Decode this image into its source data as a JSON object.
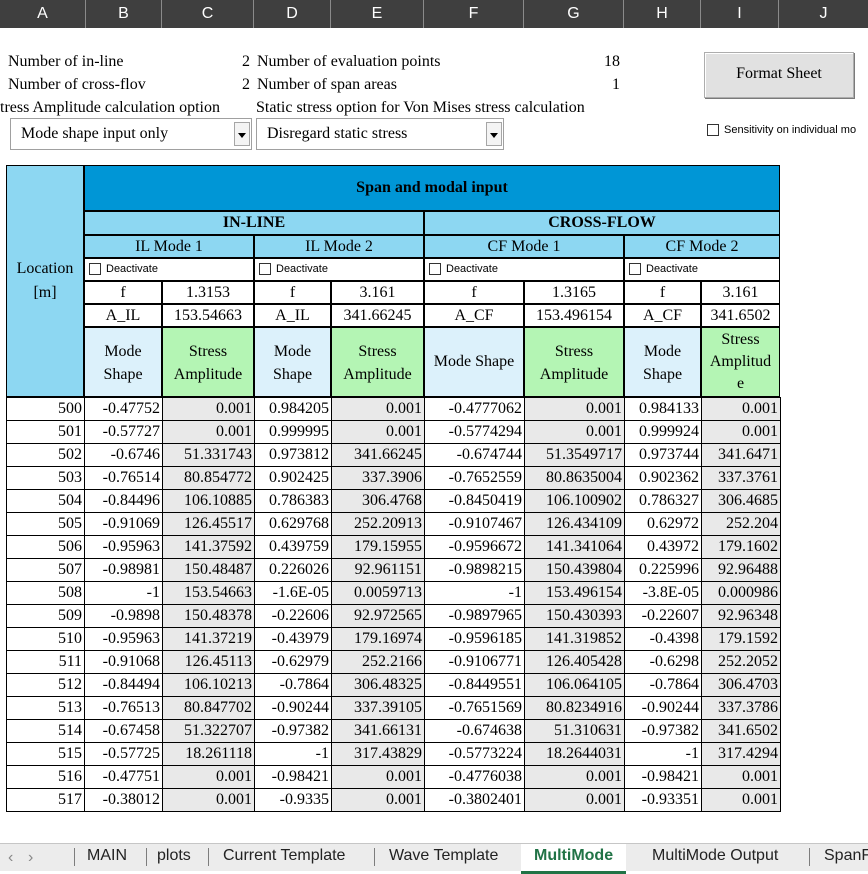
{
  "columns": [
    "A",
    "B",
    "C",
    "D",
    "E",
    "F",
    "G",
    "H",
    "I",
    "J"
  ],
  "info": {
    "inline_label": "Number of in-line",
    "inline_value": "2",
    "crossflow_label": "Number of cross-flov",
    "crossflow_value": "2",
    "eval_label": "Number of evaluation points",
    "eval_value": "18",
    "span_label": "Number of span areas",
    "span_value": "1",
    "stress_option_label": "tress Amplitude calculation option",
    "static_option_label": "Static stress option for Von Mises stress calculation"
  },
  "dropdowns": {
    "mode_shape": "Mode shape input only",
    "static_stress": "Disregard static stress"
  },
  "format_button": "Format Sheet",
  "sensitivity_label": "Sensitivity on individual mo",
  "table": {
    "title": "Span and modal input",
    "location_label_1": "Location",
    "location_label_2": "[m]",
    "inline": "IN-LINE",
    "crossflow": "CROSS-FLOW",
    "modes": [
      "IL Mode 1",
      "IL Mode 2",
      "CF Mode 1",
      "CF Mode 2"
    ],
    "deactivate": "Deactivate",
    "f_label": "f",
    "f_values": [
      "1.3153",
      "3.161",
      "1.3165",
      "3.161"
    ],
    "a_labels": [
      "A_IL",
      "A_IL",
      "A_CF",
      "A_CF"
    ],
    "a_values": [
      "153.54663",
      "341.66245",
      "153.496154",
      "341.6502"
    ],
    "mode_shape_1": "Mode",
    "mode_shape_2": "Shape",
    "mode_shape_full": "Mode Shape",
    "stress_1": "Stress",
    "stress_2": "Amplitude",
    "stress_a": "Amplitud",
    "stress_b": "e",
    "rows": [
      [
        "500",
        "-0.47752",
        "0.001",
        "0.984205",
        "0.001",
        "-0.4777062",
        "0.001",
        "0.984133",
        "0.001"
      ],
      [
        "501",
        "-0.57727",
        "0.001",
        "0.999995",
        "0.001",
        "-0.5774294",
        "0.001",
        "0.999924",
        "0.001"
      ],
      [
        "502",
        "-0.6746",
        "51.331743",
        "0.973812",
        "341.66245",
        "-0.674744",
        "51.3549717",
        "0.973744",
        "341.6471"
      ],
      [
        "503",
        "-0.76514",
        "80.854772",
        "0.902425",
        "337.3906",
        "-0.7652559",
        "80.8635004",
        "0.902362",
        "337.3761"
      ],
      [
        "504",
        "-0.84496",
        "106.10885",
        "0.786383",
        "306.4768",
        "-0.8450419",
        "106.100902",
        "0.786327",
        "306.4685"
      ],
      [
        "505",
        "-0.91069",
        "126.45517",
        "0.629768",
        "252.20913",
        "-0.9107467",
        "126.434109",
        "0.62972",
        "252.204"
      ],
      [
        "506",
        "-0.95963",
        "141.37592",
        "0.439759",
        "179.15955",
        "-0.9596672",
        "141.341064",
        "0.43972",
        "179.1602"
      ],
      [
        "507",
        "-0.98981",
        "150.48487",
        "0.226026",
        "92.961151",
        "-0.9898215",
        "150.439804",
        "0.225996",
        "92.96488"
      ],
      [
        "508",
        "-1",
        "153.54663",
        "-1.6E-05",
        "0.0059713",
        "-1",
        "153.496154",
        "-3.8E-05",
        "0.000986"
      ],
      [
        "509",
        "-0.9898",
        "150.48378",
        "-0.22606",
        "92.972565",
        "-0.9897965",
        "150.430393",
        "-0.22607",
        "92.96348"
      ],
      [
        "510",
        "-0.95963",
        "141.37219",
        "-0.43979",
        "179.16974",
        "-0.9596185",
        "141.319852",
        "-0.4398",
        "179.1592"
      ],
      [
        "511",
        "-0.91068",
        "126.45113",
        "-0.62979",
        "252.2166",
        "-0.9106771",
        "126.405428",
        "-0.6298",
        "252.2052"
      ],
      [
        "512",
        "-0.84494",
        "106.10213",
        "-0.7864",
        "306.48325",
        "-0.8449551",
        "106.064105",
        "-0.7864",
        "306.4703"
      ],
      [
        "513",
        "-0.76513",
        "80.847702",
        "-0.90244",
        "337.39105",
        "-0.7651569",
        "80.8234916",
        "-0.90244",
        "337.3786"
      ],
      [
        "514",
        "-0.67458",
        "51.322707",
        "-0.97382",
        "341.66131",
        "-0.674638",
        "51.310631",
        "-0.97382",
        "341.6502"
      ],
      [
        "515",
        "-0.57725",
        "18.261118",
        "-1",
        "317.43829",
        "-0.5773224",
        "18.2644031",
        "-1",
        "317.4294"
      ],
      [
        "516",
        "-0.47751",
        "0.001",
        "-0.98421",
        "0.001",
        "-0.4776038",
        "0.001",
        "-0.98421",
        "0.001"
      ],
      [
        "517",
        "-0.38012",
        "0.001",
        "-0.9335",
        "0.001",
        "-0.3802401",
        "0.001",
        "-0.93351",
        "0.001"
      ]
    ]
  },
  "sheet_tabs": [
    "MAIN",
    "plots",
    "Current Template",
    "Wave Template",
    "MultiMode",
    "MultiMode Output",
    "SpanF"
  ],
  "active_tab": "MultiMode",
  "colors": {
    "header_blue": "#0096d6",
    "light_blue": "#8dd7f2",
    "pale_blue": "#dcf1fb",
    "light_green": "#b4f5b4",
    "tab_active": "#217346"
  }
}
